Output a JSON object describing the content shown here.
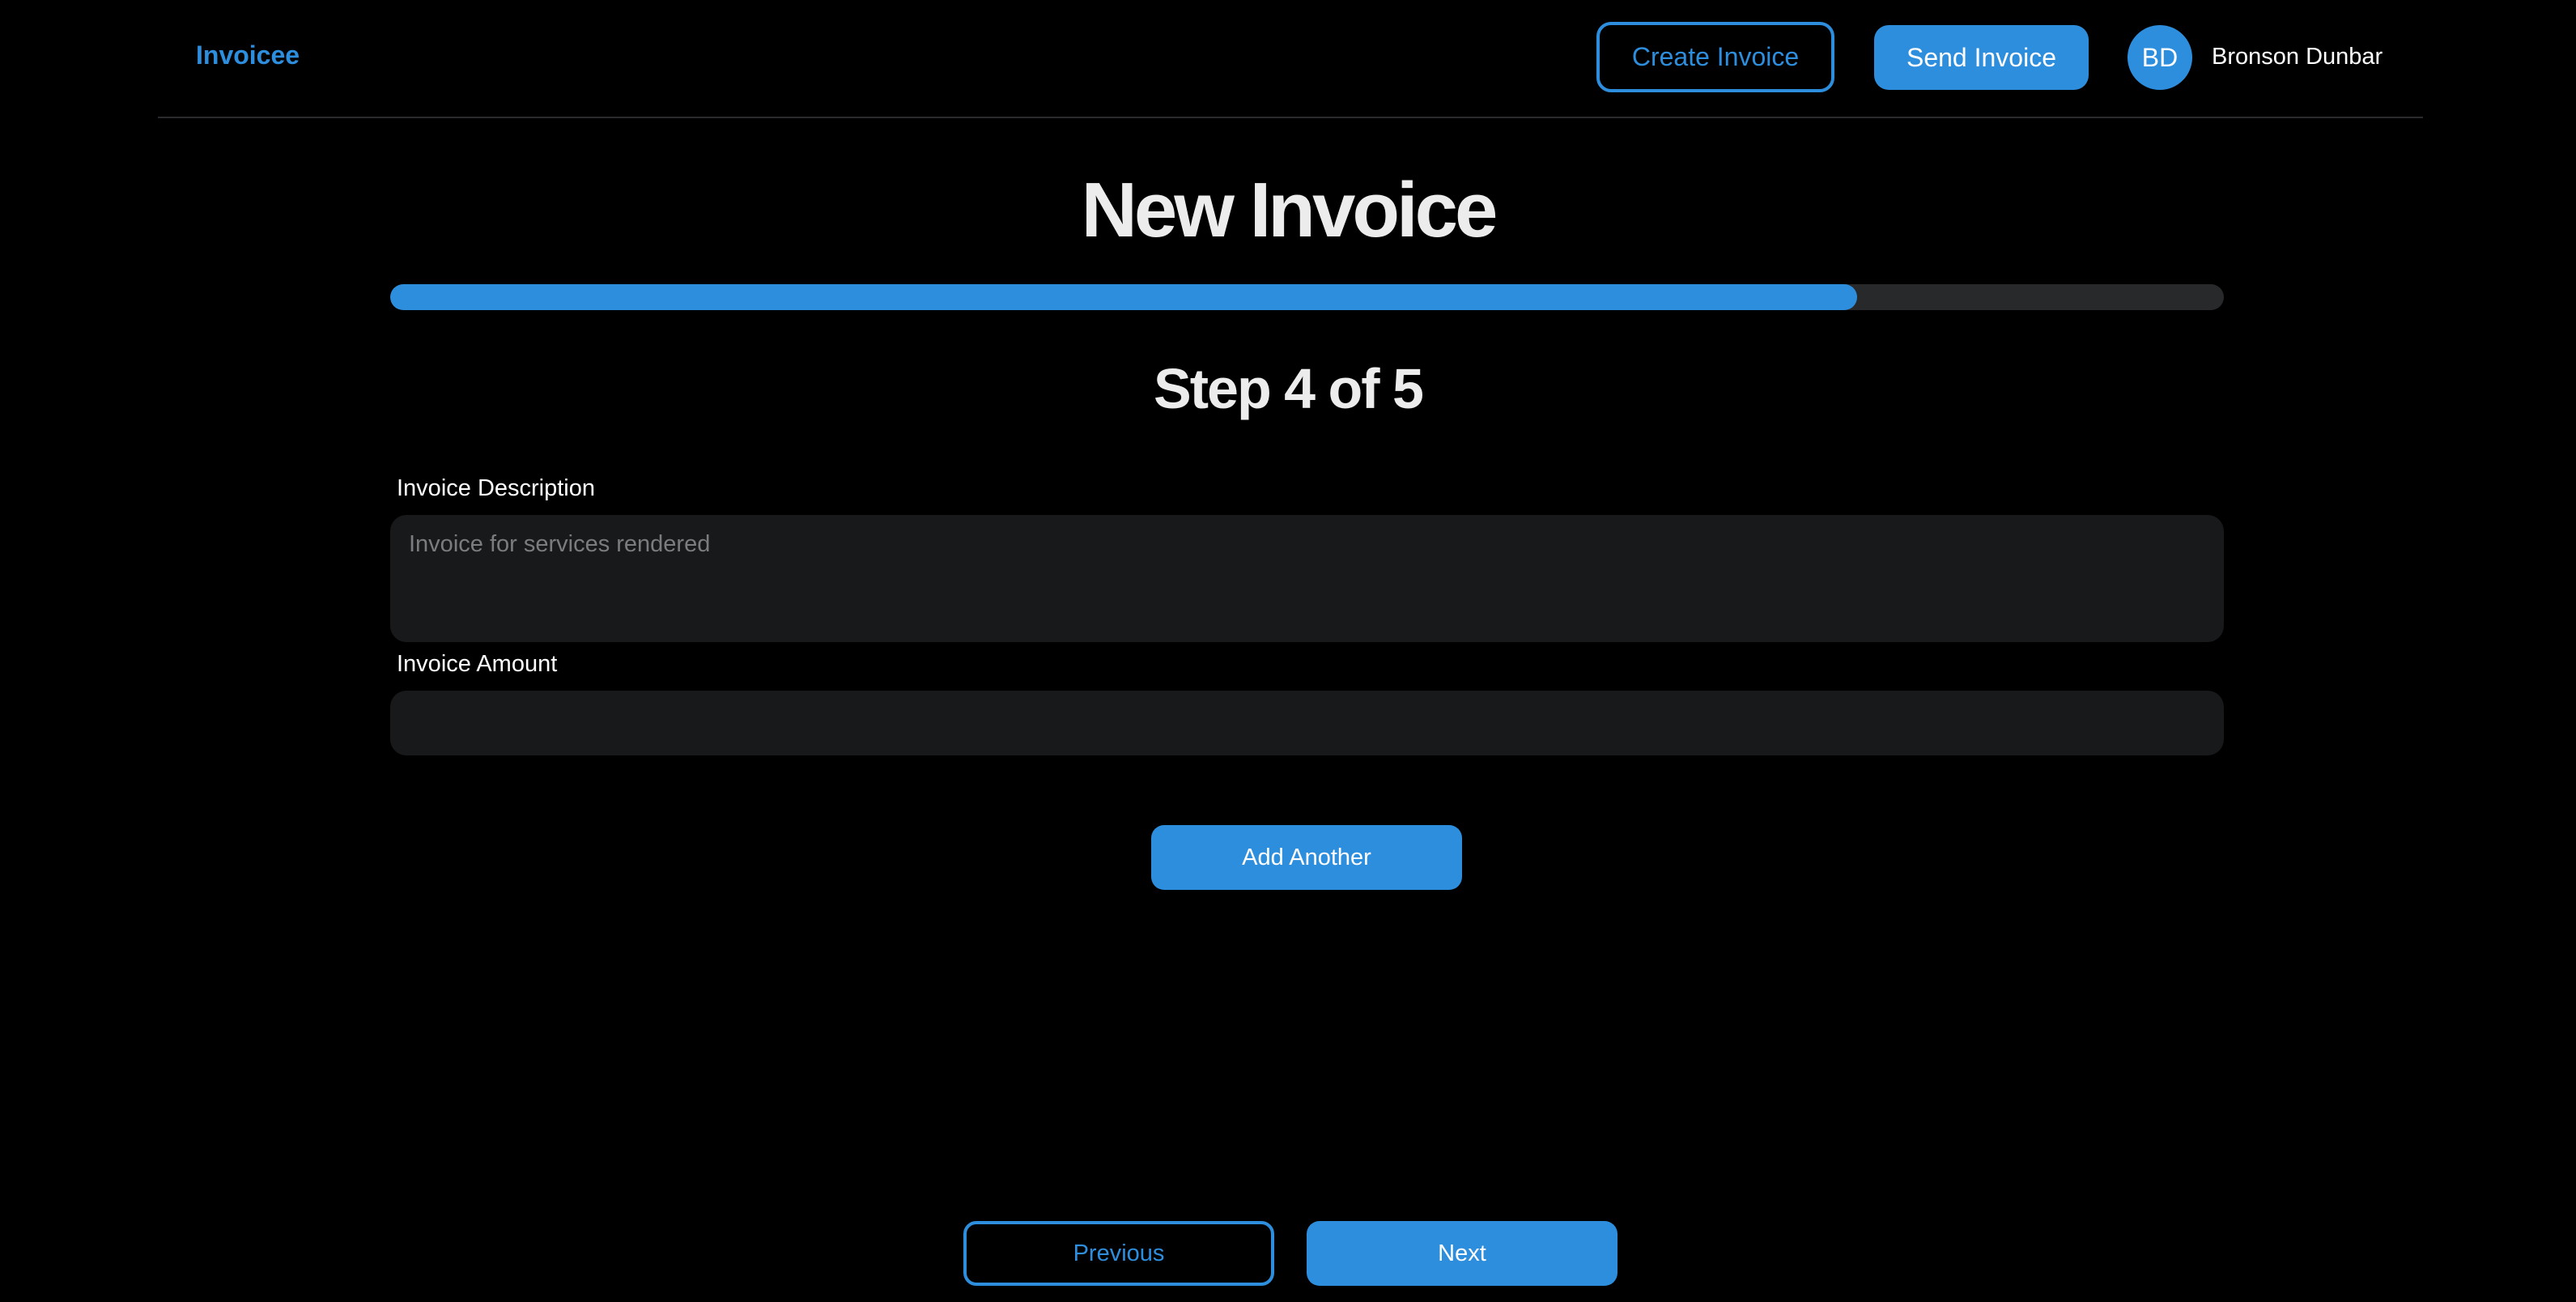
{
  "app": {
    "brand": "Invoicee"
  },
  "header": {
    "create_invoice_label": "Create Invoice",
    "send_invoice_label": "Send Invoice",
    "user": {
      "initials": "BD",
      "name": "Bronson Dunbar"
    }
  },
  "page": {
    "title": "New Invoice",
    "step_label": "Step 4 of 5",
    "progress": {
      "current_step": 4,
      "total_steps": 5,
      "fill_fraction": 0.8
    }
  },
  "form": {
    "description": {
      "label": "Invoice Description",
      "placeholder": "Invoice for services rendered",
      "value": ""
    },
    "amount": {
      "label": "Invoice Amount",
      "placeholder": "",
      "value": ""
    },
    "add_another_label": "Add Another"
  },
  "footer": {
    "previous_label": "Previous",
    "next_label": "Next"
  },
  "colors": {
    "accent": "#2e8ede",
    "background": "#000000",
    "field_background": "#18191b",
    "progress_track": "#28292b"
  }
}
